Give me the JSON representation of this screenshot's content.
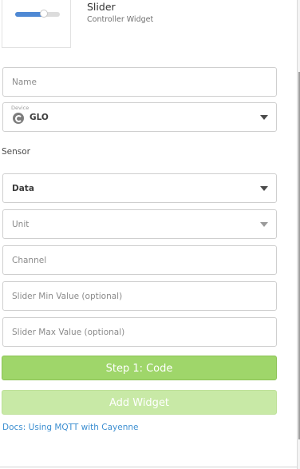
{
  "widget": {
    "title": "Slider",
    "subtitle": "Controller Widget",
    "preview_value": 0.65,
    "preview_track_color": "#dcdcdc",
    "preview_fill_color": "#4f89d4"
  },
  "form": {
    "name_placeholder": "Name",
    "device_label": "Device",
    "device_icon": "cayenne-device-icon",
    "device_value": "GLO",
    "sensor_section_label": "Sensor",
    "data_value": "Data",
    "unit_placeholder": "Unit",
    "channel_placeholder": "Channel",
    "slider_min_placeholder": "Slider Min Value (optional)",
    "slider_max_placeholder": "Slider Max Value (optional)"
  },
  "actions": {
    "step1_label": "Step 1: Code",
    "add_widget_label": "Add Widget",
    "primary_color": "#9fd66a",
    "disabled_color": "#c8e9a6"
  },
  "links": {
    "docs_label": "Docs: Using MQTT with Cayenne",
    "link_color": "#3d8fd1"
  }
}
